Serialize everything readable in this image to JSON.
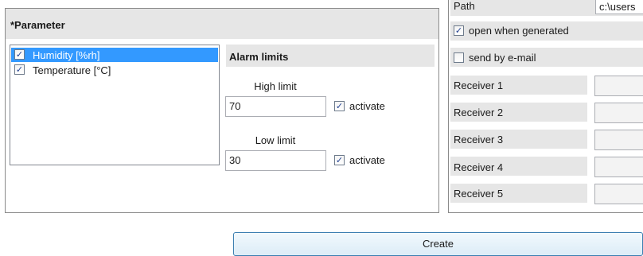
{
  "parameter": {
    "title": "*Parameter",
    "items": [
      {
        "label": "Humidity [%rh]",
        "checked": true,
        "selected": true
      },
      {
        "label": "Temperature [°C]",
        "checked": true,
        "selected": false
      }
    ]
  },
  "alarm": {
    "title": "Alarm limits",
    "high_label": "High limit",
    "high_value": "70",
    "high_activate": "activate",
    "low_label": "Low limit",
    "low_value": "30",
    "low_activate": "activate"
  },
  "output": {
    "path_label": "Path",
    "path_value": "c:\\users",
    "open_label": "open when generated",
    "send_label": "send by e-mail",
    "receivers": [
      "Receiver 1",
      "Receiver 2",
      "Receiver 3",
      "Receiver 4",
      "Receiver 5"
    ]
  },
  "actions": {
    "create_label": "Create"
  }
}
